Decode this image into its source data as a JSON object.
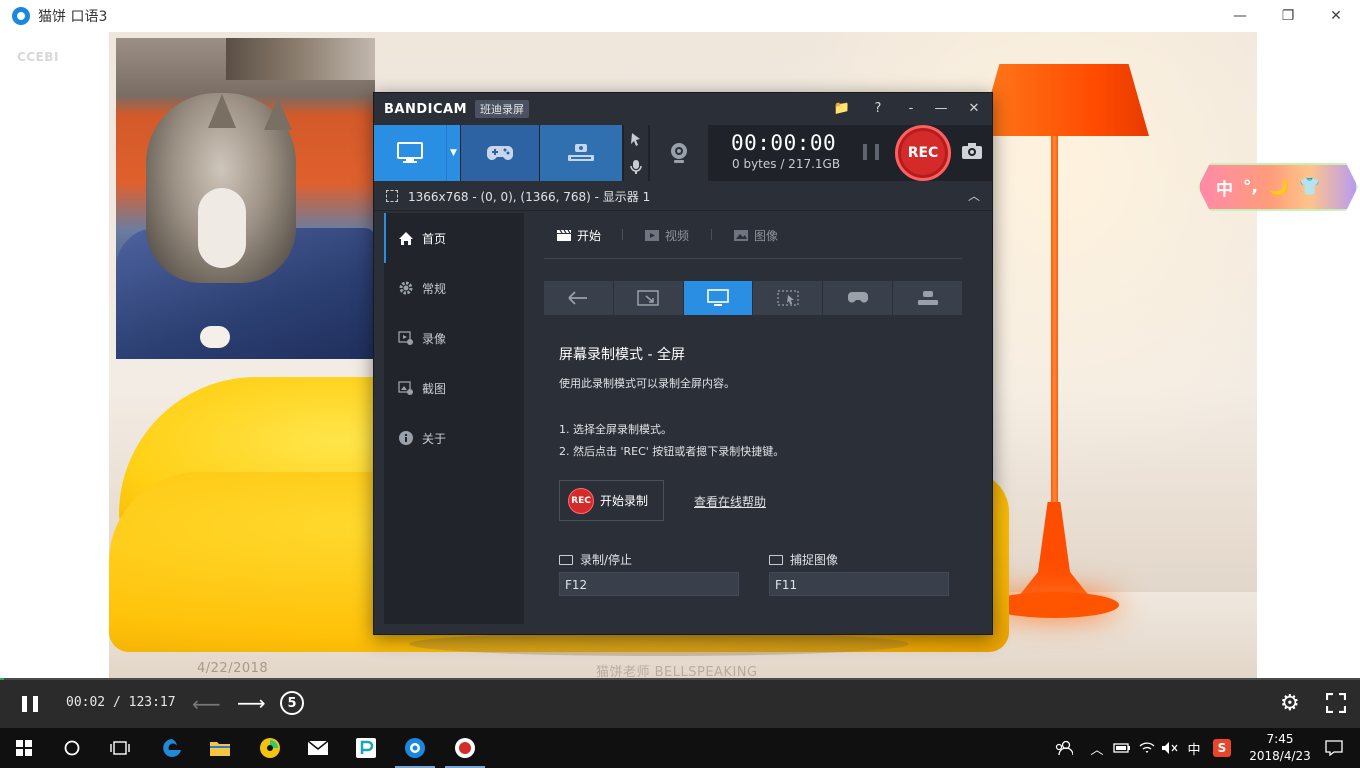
{
  "window": {
    "title": "猫饼 口语3",
    "minimize": "—",
    "maximize": "❐",
    "close": "✕"
  },
  "video": {
    "corner_mark": "CCEBI",
    "date_stamp": "4/22/2018",
    "watermark": "猫饼老师 BELLSPEAKING"
  },
  "ime": {
    "items": [
      "中",
      "°,",
      "🌙",
      "👕"
    ]
  },
  "bandicam": {
    "logo_a": "BANDI",
    "logo_b": "CAM",
    "badge": "班迪录屏",
    "title_buttons": {
      "folder": "📁",
      "help": "?",
      "dash": "-",
      "minimize": "—",
      "close": "✕"
    },
    "timer": "00:00:00",
    "file_size": "0 bytes / 217.1GB",
    "rec_label": "REC",
    "region_text": "1366x768 - (0, 0), (1366, 768) - 显示器 1",
    "region_toggle": "︿",
    "sidebar": [
      {
        "label": "首页",
        "icon": "home-icon",
        "active": true
      },
      {
        "label": "常规",
        "icon": "gear-icon",
        "active": false
      },
      {
        "label": "录像",
        "icon": "video-settings-icon",
        "active": false
      },
      {
        "label": "截图",
        "icon": "image-settings-icon",
        "active": false
      },
      {
        "label": "关于",
        "icon": "info-icon",
        "active": false
      }
    ],
    "tabs": [
      {
        "label": "开始",
        "icon": "clapper-icon",
        "active": true
      },
      {
        "label": "视频",
        "icon": "play-icon",
        "active": false
      },
      {
        "label": "图像",
        "icon": "picture-icon",
        "active": false
      }
    ],
    "mode_strip_active": 2,
    "mode_title": "屏幕录制模式 - 全屏",
    "mode_desc": "使用此录制模式可以录制全屏内容。",
    "step1": "1. 选择全屏录制模式。",
    "step2": "2. 然后点击 'REC' 按钮或者摁下录制快捷键。",
    "start_button_icon": "REC",
    "start_button_label": "开始录制",
    "help_link": "查看在线帮助",
    "hotkey_record_label": "录制/停止",
    "hotkey_record_value": "F12",
    "hotkey_capture_label": "捕捉图像",
    "hotkey_capture_value": "F11"
  },
  "player": {
    "time": "00:02 / 123:17",
    "skip_seconds": "5",
    "progress_fraction": 0.003
  },
  "taskbar": {
    "clock_time": "7:45",
    "clock_date": "2018/4/23",
    "ime_indicator": "中",
    "sogou_label": "S"
  }
}
